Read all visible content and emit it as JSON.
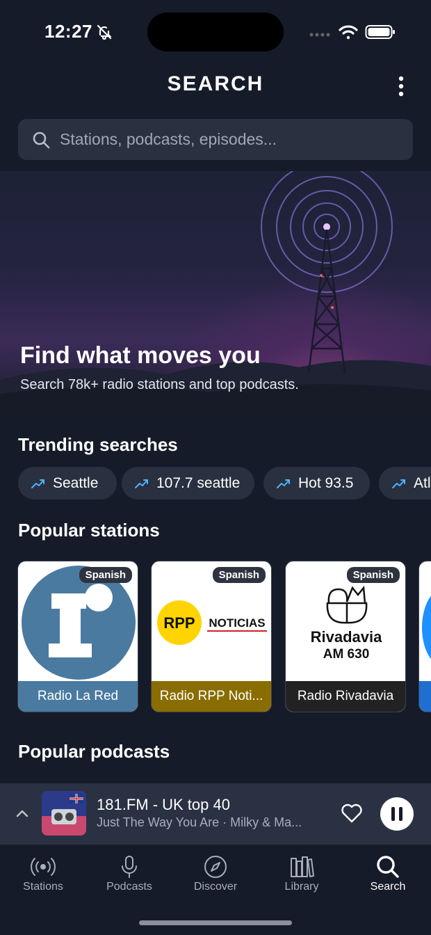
{
  "status": {
    "time": "12:27"
  },
  "header": {
    "title": "SEARCH"
  },
  "search": {
    "placeholder": "Stations, podcasts, episodes..."
  },
  "hero": {
    "title": "Find what moves you",
    "subtitle": "Search 78k+ radio stations and top podcasts."
  },
  "trending": {
    "title": "Trending searches",
    "items": [
      "Seattle",
      "107.7 seattle",
      "Hot 93.5",
      "Atl"
    ]
  },
  "popular_stations": {
    "title": "Popular stations",
    "items": [
      {
        "name": "Radio La Red",
        "badge": "Spanish",
        "logo_text": "1"
      },
      {
        "name": "Radio RPP Noti...",
        "badge": "Spanish",
        "logo_text": "RPP",
        "logo_text2": "NOTICIAS"
      },
      {
        "name": "Radio Rivadavia",
        "badge": "Spanish",
        "logo_text": "Rivadavia",
        "logo_text2": "AM 630"
      }
    ]
  },
  "popular_podcasts": {
    "title": "Popular podcasts"
  },
  "now_playing": {
    "title": "181.FM - UK top 40",
    "subtitle": "Just The Way You Are  · Milky & Ma..."
  },
  "tabs": [
    {
      "label": "Stations",
      "icon": "radio-waves-icon"
    },
    {
      "label": "Podcasts",
      "icon": "microphone-icon"
    },
    {
      "label": "Discover",
      "icon": "compass-icon"
    },
    {
      "label": "Library",
      "icon": "library-icon"
    },
    {
      "label": "Search",
      "icon": "search-icon",
      "active": true
    }
  ],
  "colors": {
    "background": "#161b29",
    "surface": "#29303f",
    "accent_text": "#ffffff",
    "rpp_bar": "#8a6d00",
    "lared_blue": "#4a7aa0"
  }
}
